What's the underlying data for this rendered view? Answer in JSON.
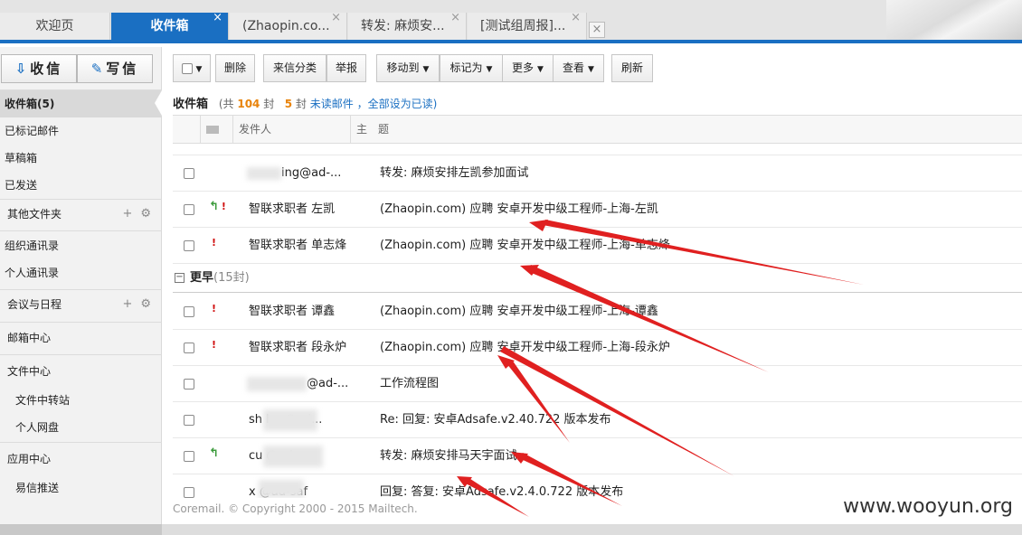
{
  "tabs": [
    {
      "label": "欢迎页"
    },
    {
      "label": "收件箱",
      "close": "×"
    },
    {
      "label": "(Zhaopin.co...",
      "close": "×"
    },
    {
      "label": "转发: 麻烦安...",
      "close": "×"
    },
    {
      "label": "[测试组周报]...",
      "close": "×"
    }
  ],
  "tab_more": "×",
  "sidebar": {
    "receive": "收信",
    "compose": "写信",
    "items": [
      {
        "label": "收件箱(5)"
      },
      {
        "label": "已标记邮件"
      },
      {
        "label": "草稿箱"
      },
      {
        "label": "已发送"
      },
      {
        "label": "其他文件夹"
      },
      {
        "label": "组织通讯录"
      },
      {
        "label": "个人通讯录"
      },
      {
        "label": "会议与日程"
      },
      {
        "label": "邮箱中心"
      },
      {
        "label": "文件中心"
      },
      {
        "label": "文件中转站"
      },
      {
        "label": "个人网盘"
      },
      {
        "label": "应用中心"
      },
      {
        "label": "易信推送"
      }
    ],
    "add_symbol": "+",
    "gear_symbol": "⚙"
  },
  "toolbar": {
    "delete": "删除",
    "classify": "来信分类",
    "report": "举报",
    "move": "移动到",
    "mark": "标记为",
    "more": "更多",
    "view": "查看",
    "refresh": "刷新"
  },
  "inbox": {
    "title": "收件箱",
    "total_prefix": "(共",
    "total": "104",
    "total_suffix": "封",
    "unread": "5",
    "unread_mid": "封",
    "unread_link": "未读邮件",
    "mark_all": "，全部设为已读)"
  },
  "columns": {
    "sender": "发件人",
    "subject": "主　题"
  },
  "rows_recent": [
    {
      "sender": "ing@ad-...",
      "subject": "转发: 麻烦安排左凯参加面试",
      "reply": false,
      "important": false
    },
    {
      "sender": "智联求职者 左凯",
      "subject": "(Zhaopin.com) 应聘 安卓开发中级工程师-上海-左凯",
      "reply": true,
      "important": true
    },
    {
      "sender": "智联求职者 单志烽",
      "subject": "(Zhaopin.com) 应聘 安卓开发中级工程师-上海-单志烽",
      "reply": false,
      "important": true
    }
  ],
  "group": {
    "label": "更早",
    "count": "(15封)"
  },
  "rows_earlier": [
    {
      "sender": "智联求职者 谭鑫",
      "subject": "(Zhaopin.com) 应聘 安卓开发中级工程师-上海-谭鑫",
      "reply": false,
      "important": true
    },
    {
      "sender": "智联求职者 段永炉",
      "subject": "(Zhaopin.com) 应聘 安卓开发中级工程师-上海-段永炉",
      "reply": false,
      "important": true
    },
    {
      "sender": "@ad-...",
      "subject": "工作流程图",
      "reply": false,
      "important": false
    },
    {
      "sender": "sh  hu @ad...",
      "subject": "Re: 回复: 安卓Adsafe.v2.40.722 版本发布",
      "reply": false,
      "important": false
    },
    {
      "sender": "cu  @ad-...",
      "subject": "转发: 麻烦安排马天宇面试",
      "reply": true,
      "important": false
    },
    {
      "sender": "x  @ad-saf",
      "subject": "回复: 答复: 安卓Adsafe.v2.4.0.722 版本发布",
      "reply": false,
      "important": false
    }
  ],
  "footer": "Coremail. © Copyright 2000 - 2015 Mailtech.",
  "watermark": "www.wooyun.org",
  "icons": {
    "reply": "reply-arrow-icon",
    "important": "exclamation-icon",
    "read_status": "envelope-icon",
    "dropdown": "caret-down-icon"
  },
  "colors": {
    "accent": "#1a6fc2",
    "count": "#e8830a",
    "arrow": "#e02020",
    "reply": "#3a9a3a",
    "important": "#d01010"
  }
}
